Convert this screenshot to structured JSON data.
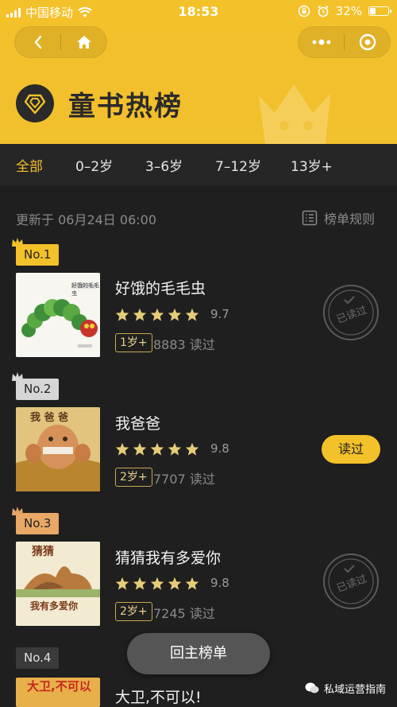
{
  "status_bar": {
    "carrier": "中国移动",
    "time": "18:53",
    "battery": "32%"
  },
  "header": {
    "title": "童书热榜"
  },
  "tabs": [
    {
      "label": "全部",
      "active": true
    },
    {
      "label": "0–2岁",
      "active": false
    },
    {
      "label": "3–6岁",
      "active": false
    },
    {
      "label": "7–12岁",
      "active": false
    },
    {
      "label": "13岁+",
      "active": false
    }
  ],
  "meta": {
    "updated": "更新于 06月24日 06:00",
    "rules_label": "榜单规则"
  },
  "books": [
    {
      "rank": "No.1",
      "title": "好饿的毛毛虫",
      "score": "9.7",
      "age": "1岁+",
      "reads": "8883 读过",
      "status": "已读过",
      "cover_text": "好饿的毛毛虫"
    },
    {
      "rank": "No.2",
      "title": "我爸爸",
      "score": "9.8",
      "age": "2岁+",
      "reads": "7707 读过",
      "status": "读过",
      "cover_text": "我 爸 爸"
    },
    {
      "rank": "No.3",
      "title": "猜猜我有多爱你",
      "score": "9.8",
      "age": "2岁+",
      "reads": "7245 读过",
      "status": "已读过",
      "cover_text": "猜猜",
      "cover_text2": "我有多爱你"
    },
    {
      "rank": "No.4",
      "title": "大卫,不可以!",
      "cover_text": "大卫,不可以"
    }
  ],
  "back_button": "回主榜单",
  "watermark": "私域运营指南",
  "colors": {
    "accent": "#f3c12a",
    "background": "#1f1f1f"
  }
}
